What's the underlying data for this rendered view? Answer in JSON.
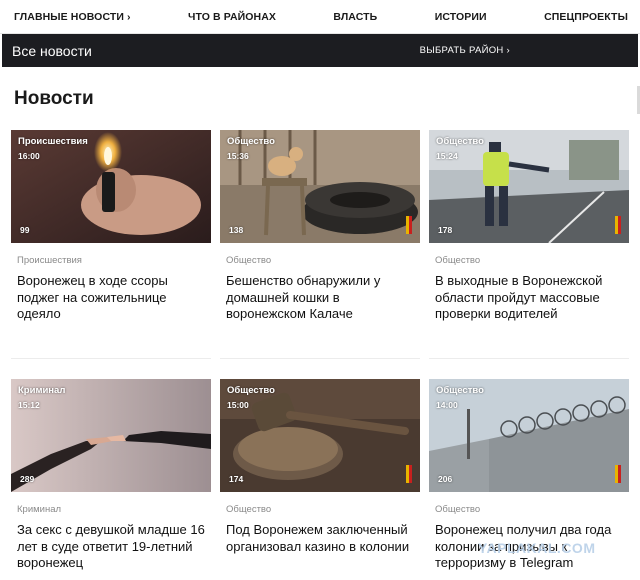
{
  "nav": {
    "items": [
      {
        "label": "ГЛАВНЫЕ НОВОСТИ ›"
      },
      {
        "label": "ЧТО В РАЙОНАХ"
      },
      {
        "label": "ВЛАСТЬ"
      },
      {
        "label": "ИСТОРИИ"
      },
      {
        "label": "СПЕЦПРОЕКТЫ"
      }
    ]
  },
  "bar": {
    "all_news": "Все новости",
    "choose_region": "ВЫБРАТЬ РАЙОН ›"
  },
  "page": {
    "heading": "Новости"
  },
  "cards": [
    {
      "thumb_category": "Происшествия",
      "time": "16:00",
      "views": "99",
      "category": "Происшествия",
      "title": "Воронежец в ходе ссоры поджег на сожительнице одеяло",
      "image": "lighter-in-hand-photo"
    },
    {
      "thumb_category": "Общество",
      "time": "15:36",
      "views": "138",
      "category": "Общество",
      "title": "Бешенство обнаружили у домашней кошки в воронежском Калаче",
      "image": "cat-on-tires-photo"
    },
    {
      "thumb_category": "Общество",
      "time": "15:24",
      "views": "178",
      "category": "Общество",
      "title": "В выходные в Воронежской области пройдут массовые проверки водителей",
      "image": "traffic-police-officer-photo"
    },
    {
      "thumb_category": "Криминал",
      "time": "15:12",
      "views": "289",
      "category": "Криминал",
      "title": "За секс с девушкой младше 16 лет в суде ответит 19-летний воронежец",
      "image": "reaching-hands-photo"
    },
    {
      "thumb_category": "Общество",
      "time": "15:00",
      "views": "174",
      "category": "Общество",
      "title": "Под Воронежем заключенный организовал казино в колонии",
      "image": "judge-gavel-photo"
    },
    {
      "thumb_category": "Общество",
      "time": "14:00",
      "views": "206",
      "category": "Общество",
      "title": "Воронежец получил два года колонии за призывы к терроризму в Telegram",
      "image": "barbed-wire-fence-photo"
    }
  ],
  "watermark": "YAPLAKAL.COM"
}
